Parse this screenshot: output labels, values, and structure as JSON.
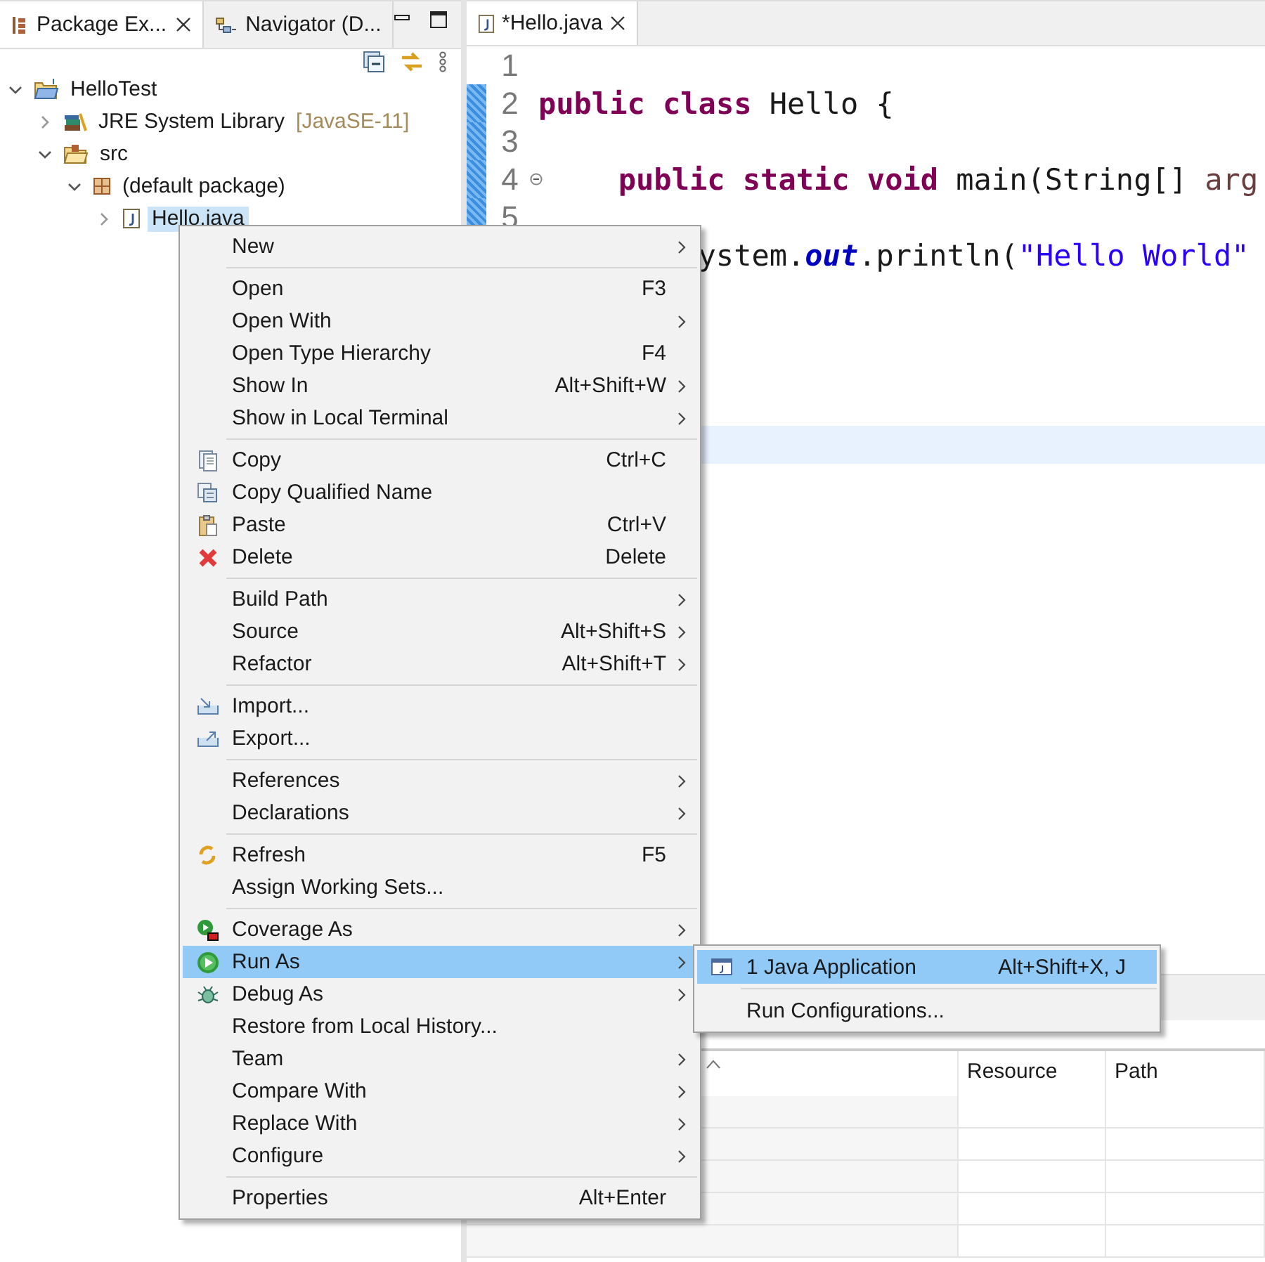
{
  "explorer": {
    "tabs": [
      {
        "label": "Package Ex...",
        "selected": true,
        "closable": true
      },
      {
        "label": "Navigator (D...",
        "selected": false,
        "closable": false
      }
    ],
    "tree": [
      {
        "label": "HelloTest",
        "expanded": true,
        "selected": false,
        "children": [
          {
            "label": "JRE System Library",
            "decoration": "[JavaSE-11]",
            "expanded": false,
            "selected": false
          },
          {
            "label": "src",
            "expanded": true,
            "selected": false,
            "children": [
              {
                "label": "(default package)",
                "expanded": true,
                "selected": false,
                "children": [
                  {
                    "label": "Hello.java",
                    "expanded": false,
                    "selected": true
                  }
                ]
              }
            ]
          }
        ]
      }
    ]
  },
  "editor": {
    "tab": {
      "label": "*Hello.java",
      "selected": true
    },
    "lines": [
      {
        "number": "1",
        "changed": false
      },
      {
        "number": "2",
        "changed": true,
        "tokens": [
          {
            "kind": "keyword",
            "text": "public "
          },
          {
            "kind": "keyword",
            "text": "class "
          },
          {
            "kind": "plain",
            "text": "Hello {"
          }
        ],
        "children": [
          {
            "number": "3",
            "changed": true
          },
          {
            "number": "4",
            "changed": true,
            "collapsible": true,
            "tokens": [
              {
                "kind": "keyword",
                "text": "public "
              },
              {
                "kind": "keyword",
                "text": "static "
              },
              {
                "kind": "keyword",
                "text": "void "
              },
              {
                "kind": "plain",
                "text": "main(String[] "
              },
              {
                "kind": "param",
                "text": "arg"
              }
            ],
            "children": [
              {
                "number": "5",
                "changed": true
              },
              {
                "tokens": [
                  {
                    "kind": "plain",
                    "text": "ystem."
                  },
                  {
                    "kind": "field",
                    "text": "out"
                  },
                  {
                    "kind": "plain",
                    "text": ".println("
                  },
                  {
                    "kind": "string",
                    "text": "\"Hello World\""
                  }
                ]
              }
            ]
          }
        ]
      },
      {
        "current": false
      },
      {
        "current": false
      },
      {
        "current": false
      },
      {
        "current": false
      },
      {
        "current": true
      }
    ]
  },
  "problems_table": {
    "columns": [
      {
        "label": "Resource"
      },
      {
        "label": "Path"
      }
    ]
  },
  "context_menu": {
    "groups": [
      [
        {
          "label": "New",
          "submenu": true,
          "selected": false
        }
      ],
      [
        {
          "label": "Open",
          "shortcut": "F3",
          "submenu": false,
          "selected": false
        },
        {
          "label": "Open With",
          "submenu": true,
          "selected": false
        },
        {
          "label": "Open Type Hierarchy",
          "shortcut": "F4",
          "submenu": false,
          "selected": false
        },
        {
          "label": "Show In",
          "shortcut": "Alt+Shift+W",
          "submenu": true,
          "selected": false
        },
        {
          "label": "Show in Local Terminal",
          "submenu": true,
          "selected": false
        }
      ],
      [
        {
          "label": "Copy",
          "shortcut": "Ctrl+C",
          "submenu": false,
          "selected": false
        },
        {
          "label": "Copy Qualified Name",
          "submenu": false,
          "selected": false
        },
        {
          "label": "Paste",
          "shortcut": "Ctrl+V",
          "submenu": false,
          "selected": false
        },
        {
          "label": "Delete",
          "shortcut": "Delete",
          "submenu": false,
          "selected": false
        }
      ],
      [
        {
          "label": "Build Path",
          "submenu": true,
          "selected": false
        },
        {
          "label": "Source",
          "shortcut": "Alt+Shift+S",
          "submenu": true,
          "selected": false
        },
        {
          "label": "Refactor",
          "shortcut": "Alt+Shift+T",
          "submenu": true,
          "selected": false
        }
      ],
      [
        {
          "label": "Import...",
          "submenu": false,
          "selected": false
        },
        {
          "label": "Export...",
          "submenu": false,
          "selected": false
        }
      ],
      [
        {
          "label": "References",
          "submenu": true,
          "selected": false
        },
        {
          "label": "Declarations",
          "submenu": true,
          "selected": false
        }
      ],
      [
        {
          "label": "Refresh",
          "shortcut": "F5",
          "submenu": false,
          "selected": false
        },
        {
          "label": "Assign Working Sets...",
          "submenu": false,
          "selected": false
        }
      ],
      [
        {
          "label": "Coverage As",
          "submenu": true,
          "selected": false
        },
        {
          "label": "Run As",
          "submenu": true,
          "selected": true
        },
        {
          "label": "Debug As",
          "submenu": true,
          "selected": false
        },
        {
          "label": "Restore from Local History...",
          "submenu": false,
          "selected": false
        },
        {
          "label": "Team",
          "submenu": true,
          "selected": false
        },
        {
          "label": "Compare With",
          "submenu": true,
          "selected": false
        },
        {
          "label": "Replace With",
          "submenu": true,
          "selected": false
        },
        {
          "label": "Configure",
          "submenu": true,
          "selected": false
        }
      ],
      [
        {
          "label": "Properties",
          "shortcut": "Alt+Enter",
          "submenu": false,
          "selected": false
        }
      ]
    ]
  },
  "run_as_submenu": {
    "groups": [
      [
        {
          "label": "1 Java Application",
          "shortcut": "Alt+Shift+X, J",
          "selected": true
        }
      ],
      [
        {
          "label": "Run Configurations...",
          "selected": false
        }
      ]
    ]
  }
}
